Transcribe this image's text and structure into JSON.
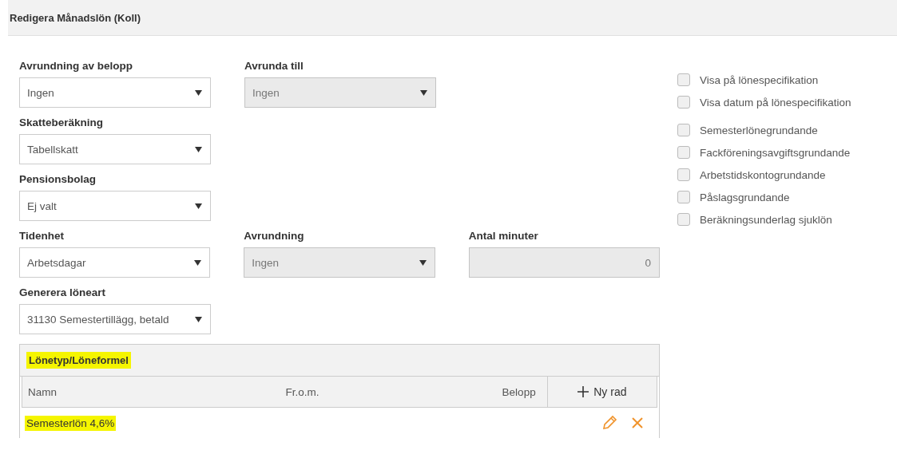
{
  "header": {
    "title": "Redigera Månadslön (Koll)"
  },
  "form_rows": [
    [
      {
        "label": "Avrundning av belopp",
        "kind": "select",
        "value": "Ingen",
        "disabled": false
      },
      {
        "label": "Avrunda till",
        "kind": "select",
        "value": "Ingen",
        "disabled": true
      }
    ],
    [
      {
        "label": "Skatteberäkning",
        "kind": "select",
        "value": "Tabellskatt",
        "disabled": false
      }
    ],
    [
      {
        "label": "Pensionsbolag",
        "kind": "select",
        "value": "Ej valt",
        "disabled": false
      }
    ],
    [
      {
        "label": "Tidenhet",
        "kind": "select",
        "value": "Arbetsdagar",
        "disabled": false
      },
      {
        "label": "Avrundning",
        "kind": "select",
        "value": "Ingen",
        "disabled": true
      },
      {
        "label": "Antal minuter",
        "kind": "number",
        "value": "0",
        "disabled": true
      }
    ],
    [
      {
        "label": "Generera löneart",
        "kind": "select",
        "value": "31130 Semestertillägg, betald",
        "disabled": false
      }
    ]
  ],
  "checkbox_groups": [
    [
      {
        "label": "Visa på lönespecifikation",
        "checked": false
      },
      {
        "label": "Visa datum på lönespecifikation",
        "checked": false
      }
    ],
    [
      {
        "label": "Semesterlönegrundande",
        "checked": false
      },
      {
        "label": "Fackföreningsavgiftsgrundande",
        "checked": false
      },
      {
        "label": "Arbetstidskontogrundande",
        "checked": false
      },
      {
        "label": "Påslagsgrundande",
        "checked": false
      },
      {
        "label": "Beräkningsunderlag sjuklön",
        "checked": false
      }
    ]
  ],
  "table": {
    "title": "Lönetyp/Löneformel",
    "title_highlighted": true,
    "columns": [
      "Namn",
      "Fr.o.m.",
      "Belopp"
    ],
    "add_button": "Ny rad",
    "rows": [
      {
        "name": "Semesterlön 4,6%",
        "highlighted": true
      }
    ]
  }
}
